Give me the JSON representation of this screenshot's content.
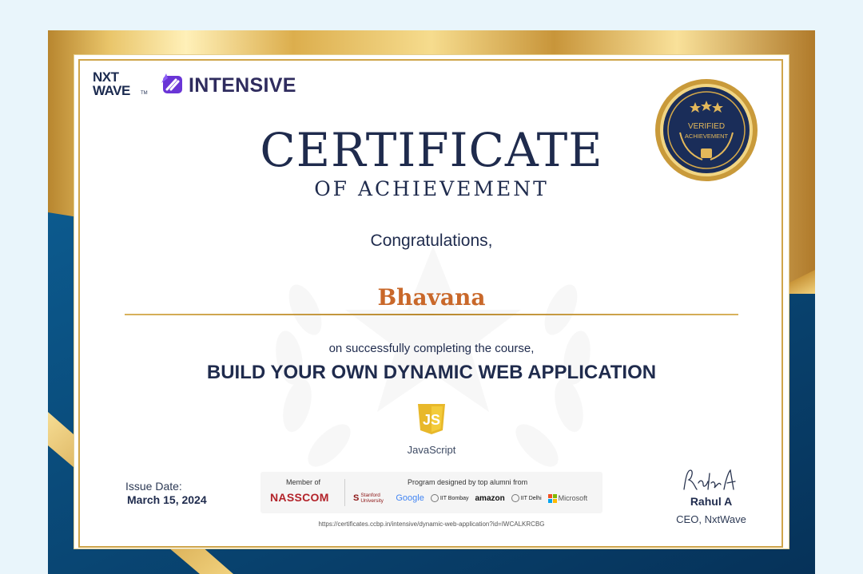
{
  "brand": {
    "logo_line1": "NXT",
    "logo_line2": "WAVE",
    "logo_tm": "TM",
    "program": "INTENSIVE"
  },
  "seal": {
    "line1": "VERIFIED",
    "line2": "ACHIEVEMENT"
  },
  "certificate": {
    "title": "CERTIFICATE",
    "subtitle": "OF ACHIEVEMENT",
    "greeting": "Congratulations,",
    "recipient": "Bhavana",
    "completion_text": "on successfully completing the course,",
    "course_name": "BUILD YOUR OWN DYNAMIC WEB APPLICATION",
    "technology": "JavaScript",
    "technology_badge": "JS"
  },
  "issue": {
    "label": "Issue Date:",
    "date": "March 15, 2024"
  },
  "partners": {
    "member_label": "Member of",
    "member": "NASSCOM",
    "program_label": "Program designed by top alumni from",
    "alumni": [
      "Stanford University",
      "Google",
      "IIT Bombay",
      "amazon",
      "IIT Delhi",
      "Microsoft"
    ]
  },
  "verification_url": "https://certificates.ccbp.in/intensive/dynamic-web-application?id=IWCALKRCBG",
  "signatory": {
    "signature": "Rahul A",
    "name": "Rahul A",
    "title": "CEO, NxtWave"
  },
  "colors": {
    "navy": "#1f2b4d",
    "gold": "#d4a849",
    "recipient": "#c9682a",
    "blue_band": "#0c4a7c"
  }
}
